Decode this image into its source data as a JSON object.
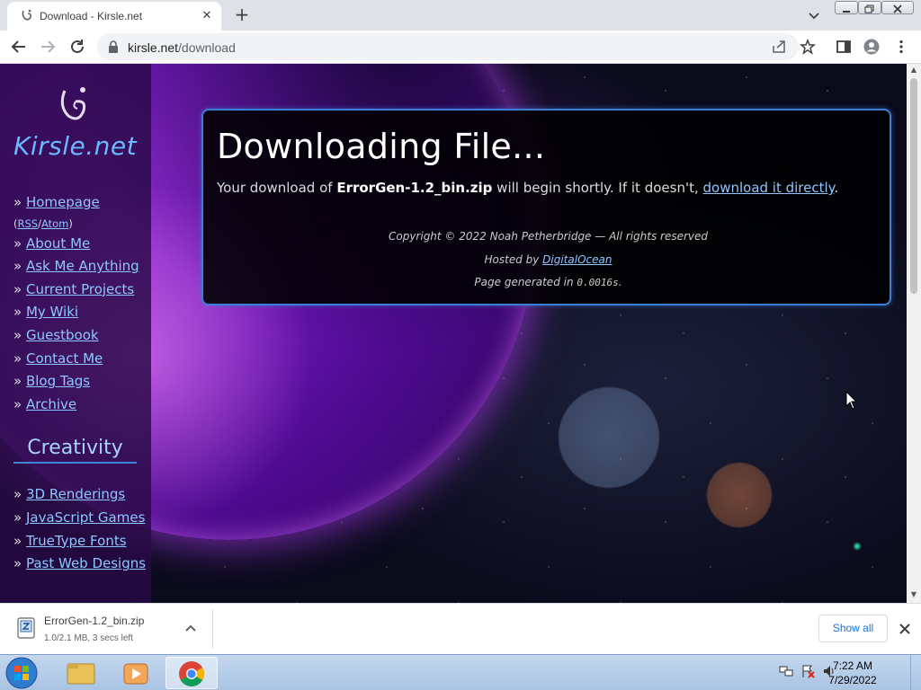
{
  "browser": {
    "tab_title": "Download - Kirsle.net",
    "url_host": "kirsle.net",
    "url_path": "/download"
  },
  "sidebar": {
    "logo_text": "Kirsle.net",
    "nav": {
      "homepage": "Homepage",
      "rss_open": "(",
      "rss": "RSS",
      "rss_sep": "/",
      "atom": "Atom",
      "rss_close": ")",
      "items": [
        "About Me",
        "Ask Me Anything",
        "Current Projects",
        "My Wiki",
        "Guestbook",
        "Contact Me",
        "Blog Tags",
        "Archive"
      ]
    },
    "creativity_title": "Creativity",
    "creativity_items": [
      "3D Renderings",
      "JavaScript Games",
      "TrueType Fonts",
      "Past Web Designs"
    ],
    "bullet": "»"
  },
  "main": {
    "heading": "Downloading File...",
    "lead_prefix": "Your download of ",
    "filename": "ErrorGen-1.2_bin.zip",
    "lead_middle": " will begin shortly. If it doesn't, ",
    "direct_link": "download it directly",
    "lead_suffix": ".",
    "copyright": "Copyright © 2022 Noah Petherbridge — All rights reserved",
    "hosted_prefix": "Hosted by ",
    "host_link": "DigitalOcean",
    "generated_prefix": "Page generated in ",
    "generated_time": "0.0016s",
    "generated_suffix": "."
  },
  "download_shelf": {
    "file_name": "ErrorGen-1.2_bin.zip",
    "status": "1.0/2.1 MB, 3 secs left",
    "show_all": "Show all"
  },
  "taskbar": {
    "time": "7:22 AM",
    "date": "7/29/2022"
  },
  "colors": {
    "link": "#8fc6ff",
    "panel_border": "#3a7fd5",
    "accent_blue": "#1a73e8"
  }
}
